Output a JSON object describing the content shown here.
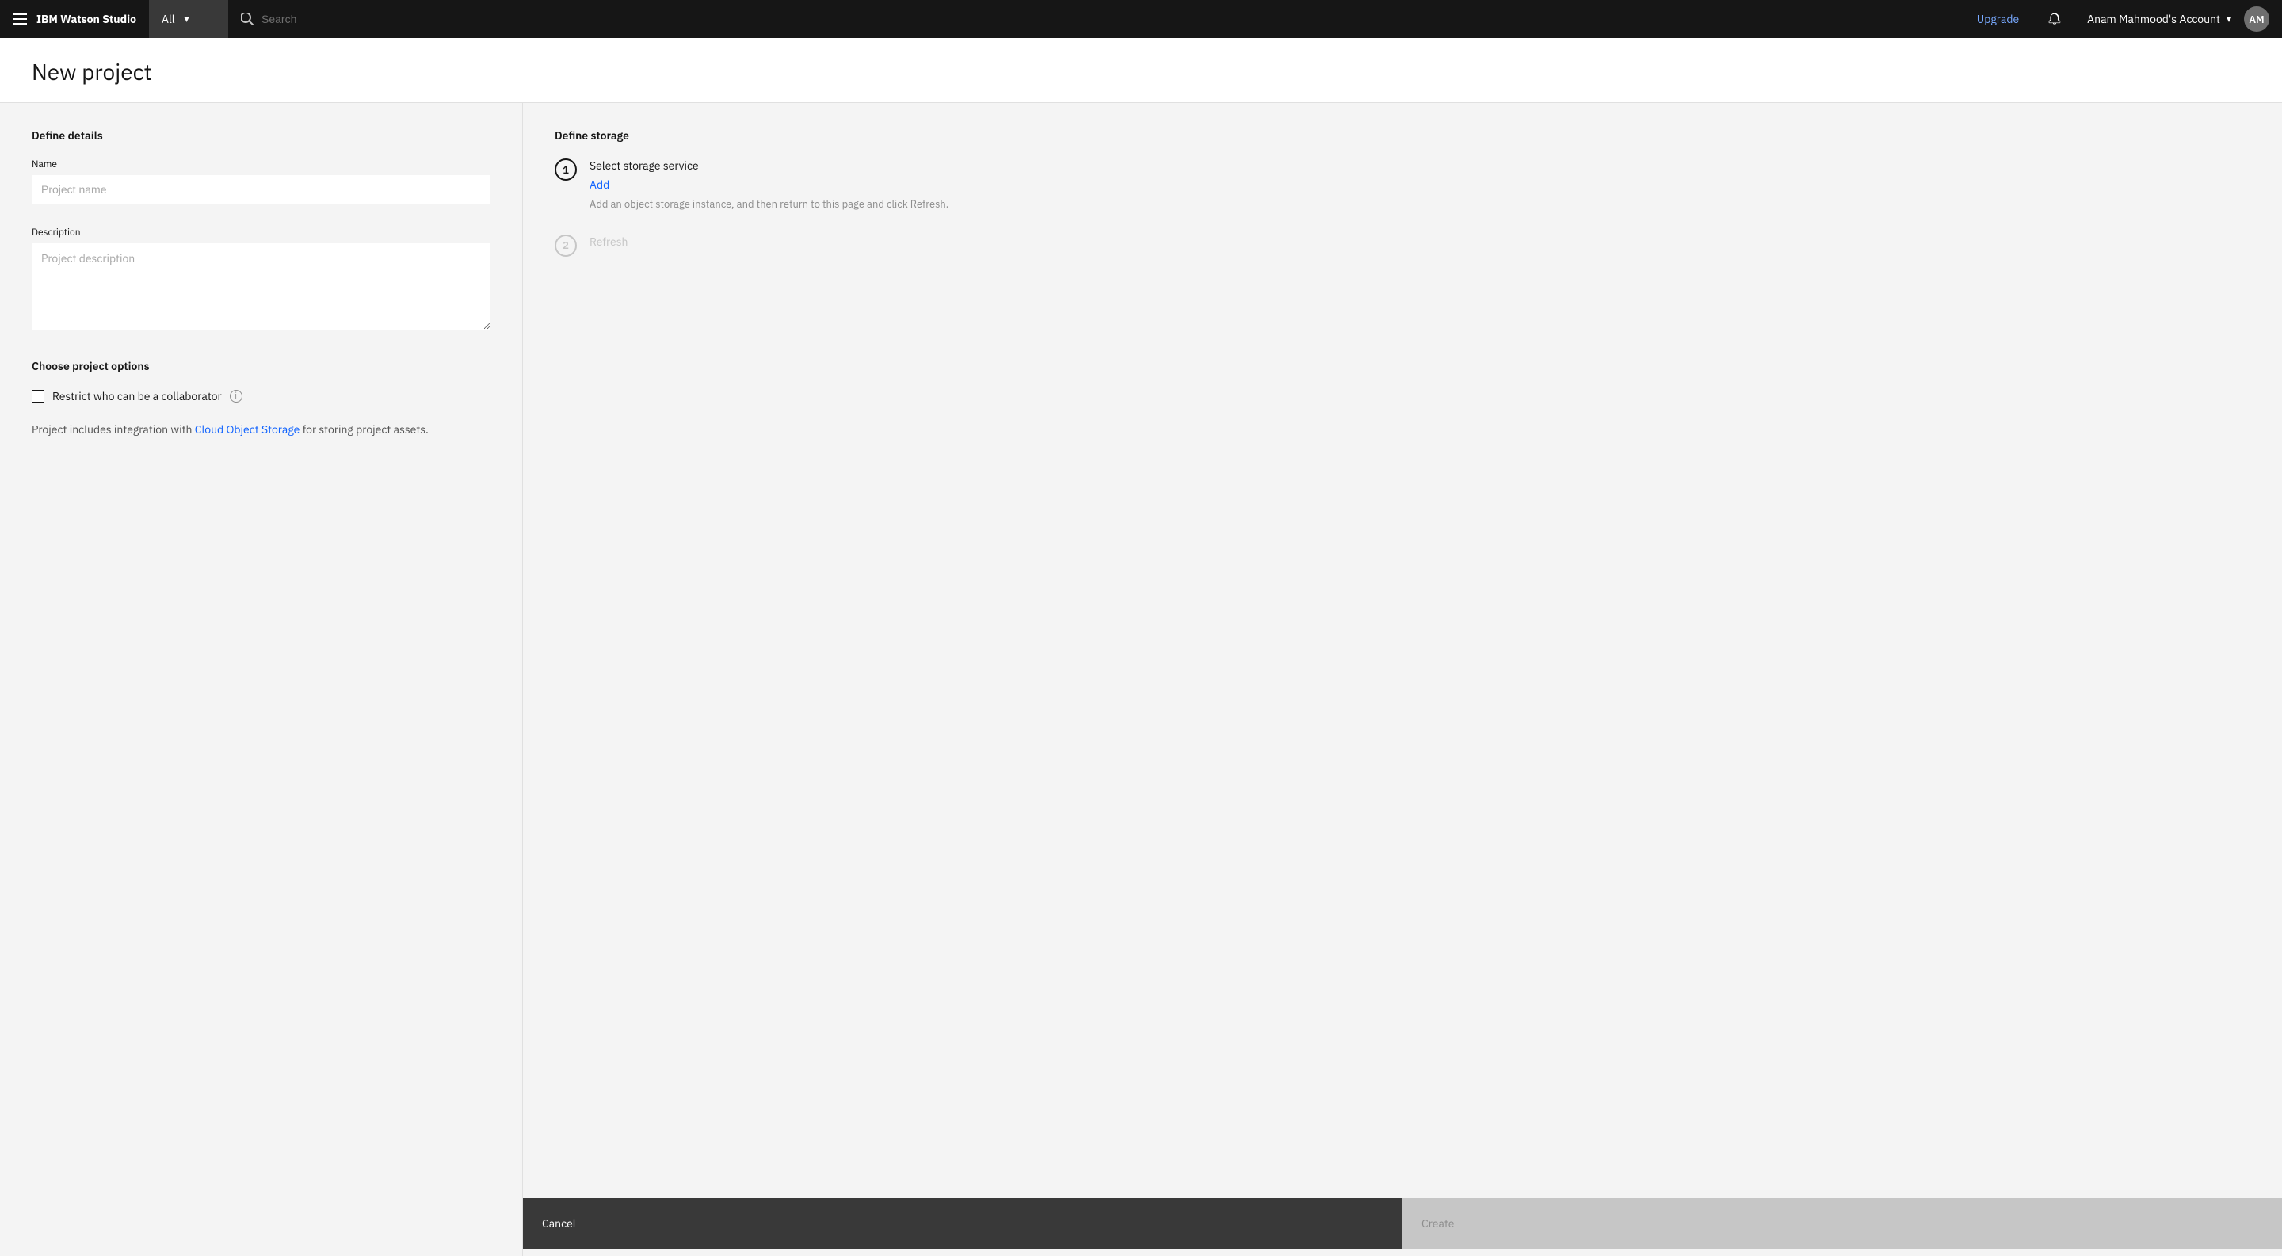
{
  "app": {
    "title_plain": "IBM ",
    "title_bold": "Watson Studio"
  },
  "header": {
    "menu_icon": "☰",
    "brand_plain": "IBM ",
    "brand_bold": "Watson Studio",
    "dropdown_label": "All",
    "search_placeholder": "Search",
    "upgrade_label": "Upgrade",
    "bell_icon": "🔔",
    "account_label": "Anam Mahmood's Account",
    "avatar_initials": "AM"
  },
  "page": {
    "title": "New project"
  },
  "left": {
    "define_details_label": "Define details",
    "name_label": "Name",
    "name_placeholder": "Project name",
    "description_label": "Description",
    "description_placeholder": "Project description",
    "choose_options_label": "Choose project options",
    "restrict_checkbox_label": "Restrict who can be a collaborator",
    "info_icon_label": "i",
    "integration_text_pre": "Project includes integration with ",
    "integration_link": "Cloud Object Storage",
    "integration_text_post": " for storing project assets."
  },
  "right": {
    "define_storage_label": "Define storage",
    "step1_number": "1",
    "step1_heading": "Select storage service",
    "step1_link": "Add",
    "step1_hint": "Add an object storage instance, and then return to this page and click Refresh.",
    "step2_number": "2",
    "step2_link": "Refresh"
  },
  "footer": {
    "cancel_label": "Cancel",
    "create_label": "Create"
  },
  "colors": {
    "accent": "#0f62fe",
    "header_bg": "#161616",
    "upgrade": "#78a9ff"
  }
}
